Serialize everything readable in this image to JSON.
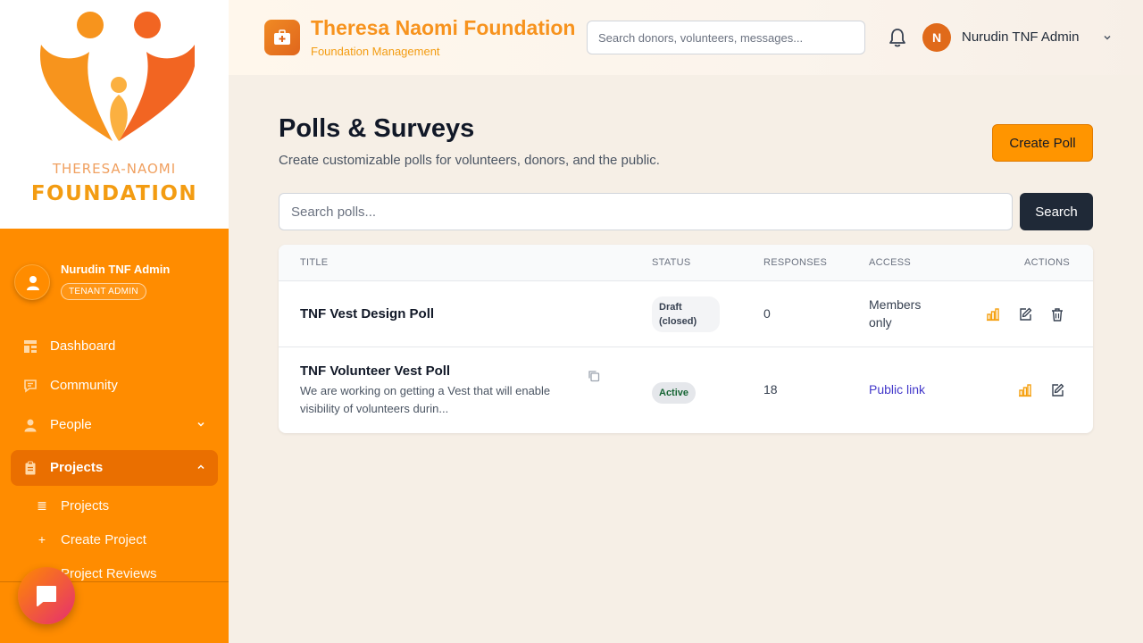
{
  "sidebar": {
    "logo_text_top": "THERESA-NAOMI",
    "logo_text_bottom": "FOUNDATION",
    "user": {
      "name": "Nurudin TNF Admin",
      "role": "TENANT ADMIN"
    },
    "nav": [
      {
        "label": "Dashboard",
        "icon": "dashboard-icon"
      },
      {
        "label": "Community",
        "icon": "chat-icon"
      },
      {
        "label": "People",
        "icon": "person-icon"
      },
      {
        "label": "Projects",
        "icon": "clipboard-icon",
        "active": true
      }
    ],
    "sub_nav": [
      {
        "label": "Projects",
        "icon": "list-icon"
      },
      {
        "label": "Create Project",
        "icon": "plus-icon"
      },
      {
        "label": "Project Reviews",
        "icon": "review-icon"
      }
    ]
  },
  "header": {
    "title": "Theresa Naomi Foundation",
    "subtitle": "Foundation Management",
    "search_placeholder": "Search donors, volunteers, messages...",
    "user_initial": "N",
    "user_name": "Nurudin TNF Admin"
  },
  "main": {
    "title": "Polls & Surveys",
    "subtitle": "Create customizable polls for volunteers, donors, and the public.",
    "create_button": "Create Poll",
    "search_placeholder": "Search polls...",
    "search_button": "Search",
    "table": {
      "columns": [
        "TITLE",
        "STATUS",
        "RESPONSES",
        "ACCESS",
        "ACTIONS"
      ],
      "rows": [
        {
          "title": "TNF Vest Design Poll",
          "description": "",
          "status": "Draft (closed)",
          "responses": "0",
          "access": "Members only",
          "access_is_link": false
        },
        {
          "title": "TNF Volunteer Vest Poll",
          "description": "We are working on getting a Vest that will enable visibility of volunteers durin...",
          "status": "Active",
          "responses": "18",
          "access": "Public link",
          "access_is_link": true
        }
      ]
    }
  },
  "colors": {
    "sidebar": "#ff8c00",
    "accent": "#f7931e",
    "link": "#4338ca",
    "dark_button": "#1f2937"
  }
}
